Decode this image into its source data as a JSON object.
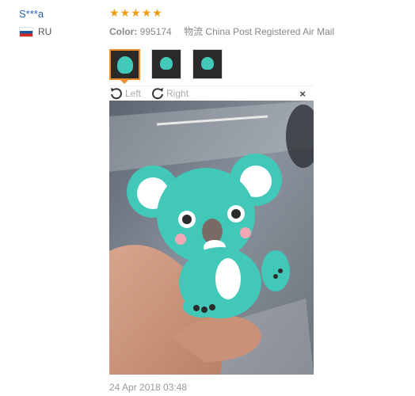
{
  "reviewer": {
    "name": "S***a",
    "country": "RU"
  },
  "rating": {
    "stars": 5
  },
  "meta": {
    "color_label": "Color:",
    "color_value": "995174",
    "shipping": "物流 China Post Registered Air Mail"
  },
  "toolbar": {
    "left_label": "Left",
    "right_label": "Right",
    "close_label": "×"
  },
  "review_date": "24 Apr 2018 03:48",
  "colors": {
    "accent": "#f08d2b",
    "star": "#f39c12",
    "link": "#2b63b7",
    "koala": "#41c8b8"
  }
}
